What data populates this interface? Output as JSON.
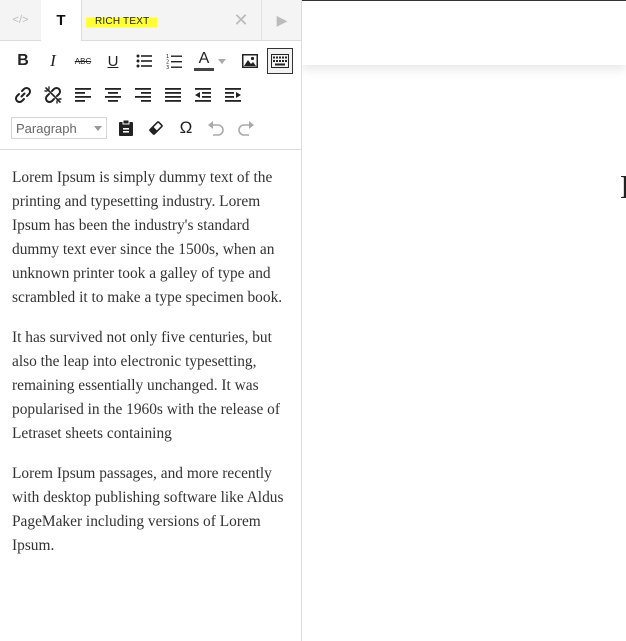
{
  "editor": {
    "tabs": {
      "code": "</>",
      "text": "T",
      "title": "RICH TEXT",
      "close": "✕",
      "play": "▶"
    },
    "toolbar": {
      "bold": "B",
      "italic": "I",
      "strike": "ABC",
      "underline": "U",
      "font_color": "A",
      "special_char": "Ω",
      "format_value": "Paragraph"
    },
    "content": [
      "Lorem Ipsum is simply dummy text of the printing and typesetting industry. Lorem Ipsum has been the industry's standard dummy text ever since the 1500s, when an unknown printer took a galley of type and scrambled it to make a type specimen book.",
      "It has survived not only five centuries, but also the leap into electronic typesetting, remaining essentially unchanged. It was popularised in the 1960s with the release of Letraset sheets containing",
      "Lorem Ipsum passages, and more recently with desktop publishing software like Aldus PageMaker including versions of Lorem Ipsum."
    ]
  },
  "canvas": {
    "edge_glyph": "E"
  },
  "colors": {
    "highlight": "#ffff33",
    "border": "#dcdcdc",
    "text": "#333333"
  }
}
